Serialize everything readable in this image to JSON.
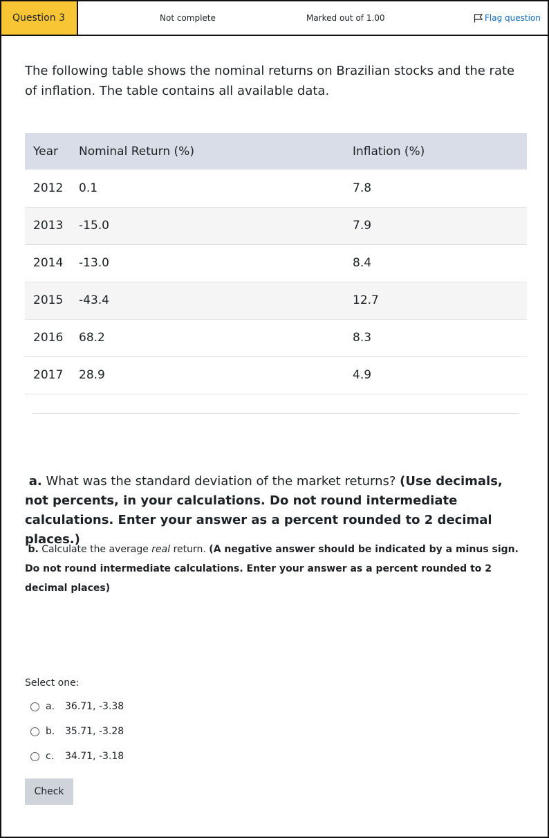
{
  "header": {
    "question_label": "Question 3",
    "status": "Not complete",
    "marks": "Marked out of 1.00",
    "flag_label": "Flag question"
  },
  "intro": "The following table shows the nominal returns on Brazilian stocks and the rate of inflation. The table contains all available data.",
  "table": {
    "headers": [
      "Year",
      "Nominal Return (%)",
      "Inflation (%)"
    ],
    "rows": [
      [
        "2012",
        "0.1",
        "7.8"
      ],
      [
        "2013",
        "-15.0",
        "7.9"
      ],
      [
        "2014",
        "-13.0",
        "8.4"
      ],
      [
        "2015",
        "-43.4",
        "12.7"
      ],
      [
        "2016",
        "68.2",
        "8.3"
      ],
      [
        "2017",
        "28.9",
        "4.9"
      ]
    ]
  },
  "part_a": {
    "prefix": "a.",
    "text": "What was the standard deviation of the market returns?",
    "instruction": "(Use decimals, not percents, in your calculations. Do not round intermediate calculations. Enter your answer as a percent rounded to 2 decimal places.)"
  },
  "part_b": {
    "prefix": "b.",
    "text_before": "Calculate the average",
    "text_italic": "real",
    "text_after": "return.",
    "instruction": "(A negative answer should be indicated by a minus sign. Do not round intermediate calculations. Enter your answer as a percent rounded to 2 decimal places)"
  },
  "select_one": "Select one:",
  "options": [
    {
      "letter": "a.",
      "value": "36.71, -3.38"
    },
    {
      "letter": "b.",
      "value": "35.71, -3.28"
    },
    {
      "letter": "c.",
      "value": "34.71, -3.18"
    }
  ],
  "check_label": "Check",
  "colors": {
    "question_badge": "#f8c534",
    "table_header": "#d8dde7",
    "link": "#0f6cbf",
    "button": "#ced4da"
  }
}
